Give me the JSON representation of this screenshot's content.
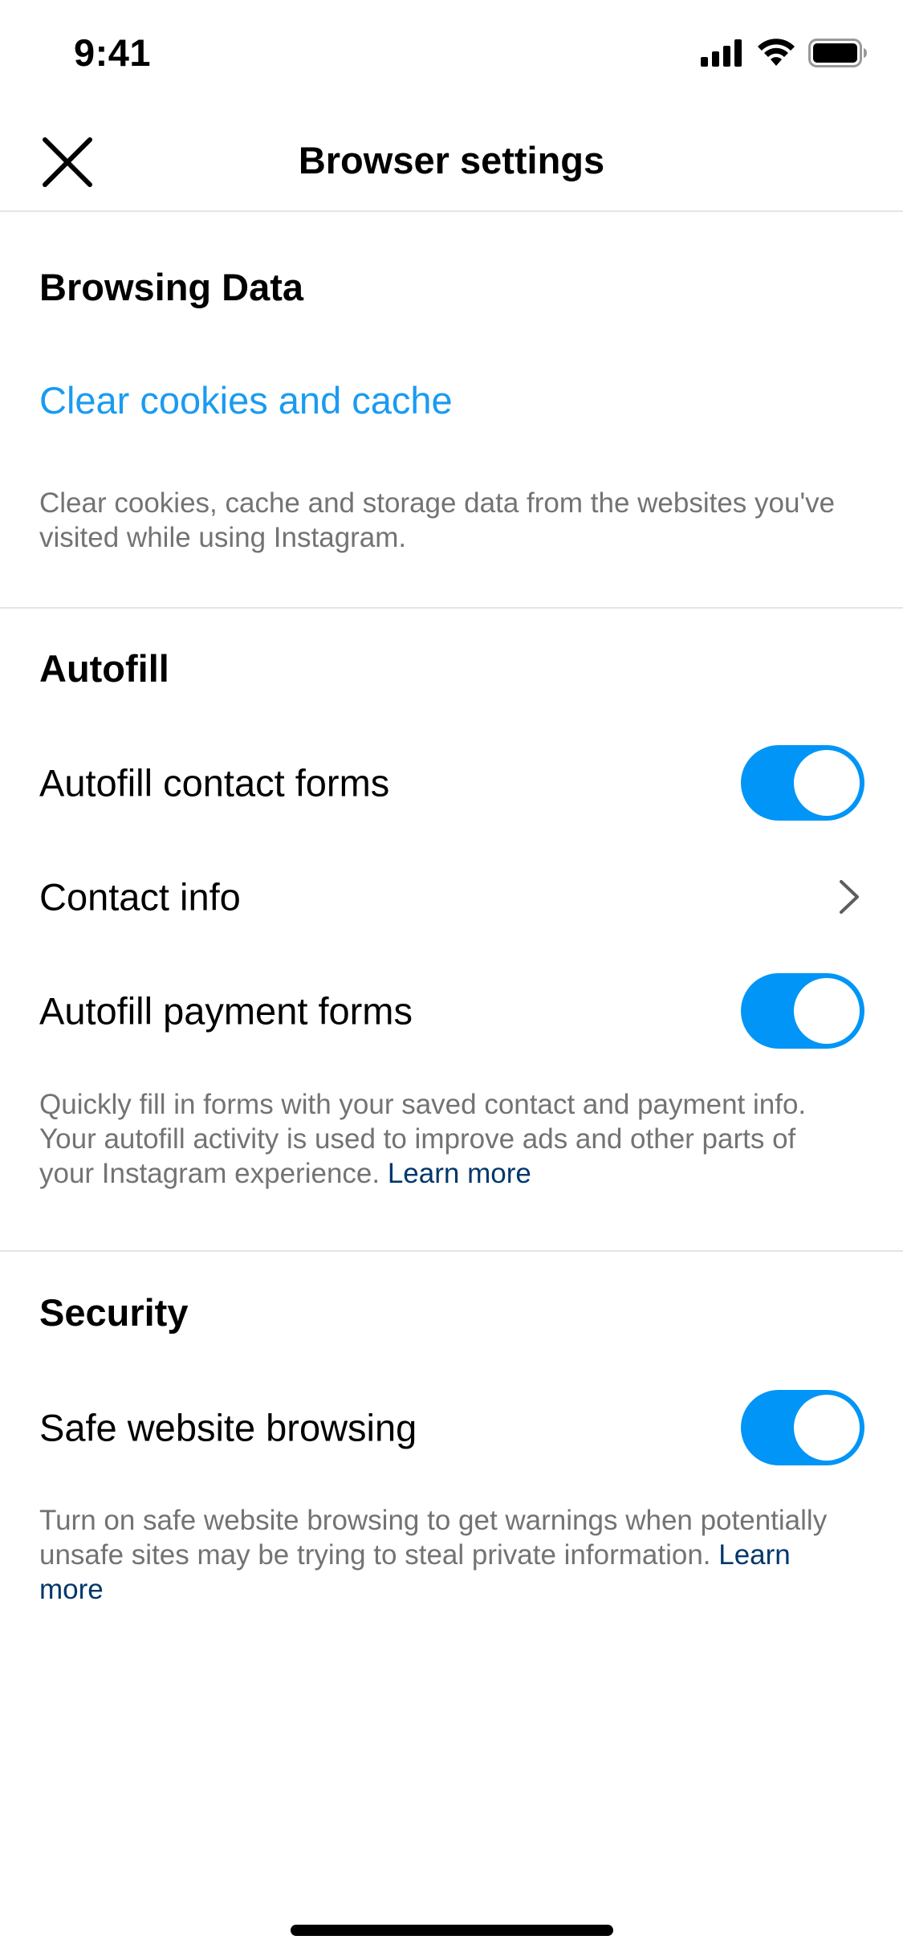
{
  "status_bar": {
    "time": "9:41",
    "icons": [
      "cellular-signal-icon",
      "wifi-icon",
      "battery-icon"
    ]
  },
  "nav": {
    "title": "Browser settings",
    "close_icon": "close-icon"
  },
  "browsing_data": {
    "heading": "Browsing Data",
    "clear_link": "Clear cookies and cache",
    "description": "Clear cookies, cache and storage data from the websites you've visited while using Instagram."
  },
  "autofill": {
    "heading": "Autofill",
    "rows": [
      {
        "label": "Autofill contact forms",
        "control": "toggle",
        "on": true
      },
      {
        "label": "Contact info",
        "control": "chevron"
      },
      {
        "label": "Autofill payment forms",
        "control": "toggle",
        "on": true
      }
    ],
    "description": "Quickly fill in forms with your saved contact and payment info. Your autofill activity is used to improve ads and other parts of your Instagram experience.",
    "learn_more": "Learn more"
  },
  "security": {
    "heading": "Security",
    "rows": [
      {
        "label": "Safe website browsing",
        "control": "toggle",
        "on": true
      }
    ],
    "description": "Turn on safe website browsing to get warnings when potentially unsafe sites may be trying to steal private information.",
    "learn_more": "Learn more"
  },
  "colors": {
    "accent_link": "#1a9bf0",
    "toggle_on": "#0095f6",
    "learn_more_link": "#00376b",
    "secondary_text": "#737373",
    "divider": "#e4e4e4"
  }
}
